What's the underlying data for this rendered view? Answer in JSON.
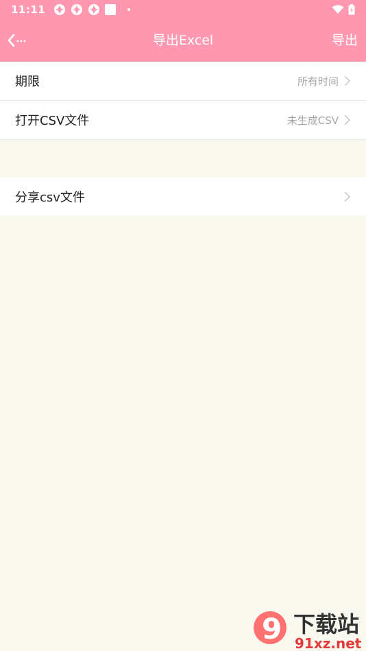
{
  "status_bar": {
    "time": "11:11",
    "notification_icons": [
      "app-notification-icon",
      "app-notification-icon",
      "app-notification-icon",
      "square-notification-icon",
      "dot-icon"
    ],
    "right_icons": [
      "wifi-icon",
      "battery-icon"
    ]
  },
  "header": {
    "title": "导出Excel",
    "action_label": "导出"
  },
  "settings": {
    "period": {
      "label": "期限",
      "value": "所有时间"
    },
    "open_csv": {
      "label": "打开CSV文件",
      "value": "未生成CSV"
    },
    "share_csv": {
      "label": "分享csv文件"
    }
  },
  "watermark": {
    "logo_text": "9",
    "title": "下载站",
    "url": "91xz.net"
  },
  "colors": {
    "header_bg": "#ff97b1",
    "page_bg": "#faf9f0",
    "row_bg": "#ffffff",
    "label": "#222222",
    "secondary": "#a6a6a6"
  }
}
